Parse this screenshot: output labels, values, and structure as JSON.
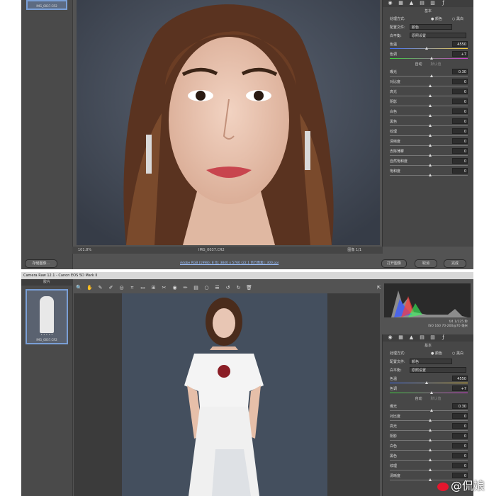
{
  "top_window": {
    "thumb_name": "IMG_0037.CR2",
    "zoom": "101.8%",
    "filename": "IMG_0037.CR2",
    "image_counter": "图像 1/1",
    "open_image_button": "打开图像",
    "cancel_button": "取消",
    "done_button": "完成",
    "batch_button": "存储图像...",
    "workflow_link": "Adobe RGB (1998); 8 位; 3840 x 5760 (22.1 百万像素); 300 ppi",
    "panel_title": "基本",
    "treatment_label": "处理方式:",
    "treatment_color": "颜色",
    "treatment_bw": "黑白",
    "profile_label": "配置文件:",
    "profile_value": "颜色",
    "wb_label": "白平衡:",
    "wb_value": "原照设置",
    "auto_label": "自动",
    "default_label": "默认值",
    "sliders": [
      {
        "label": "色温",
        "value": "4550",
        "pos": 0.45
      },
      {
        "label": "色调",
        "value": "+7",
        "pos": 0.52
      },
      {
        "label": "曝光",
        "value": "0.30",
        "pos": 0.52
      },
      {
        "label": "对比度",
        "value": "0",
        "pos": 0.5
      },
      {
        "label": "高光",
        "value": "0",
        "pos": 0.5
      },
      {
        "label": "阴影",
        "value": "0",
        "pos": 0.5
      },
      {
        "label": "白色",
        "value": "0",
        "pos": 0.5
      },
      {
        "label": "黑色",
        "value": "0",
        "pos": 0.5
      },
      {
        "label": "纹理",
        "value": "0",
        "pos": 0.5
      },
      {
        "label": "清晰度",
        "value": "0",
        "pos": 0.5
      },
      {
        "label": "去除薄雾",
        "value": "0",
        "pos": 0.5
      },
      {
        "label": "自然饱和度",
        "value": "0",
        "pos": 0.5
      },
      {
        "label": "饱和度",
        "value": "0",
        "pos": 0.5
      }
    ]
  },
  "bottom_window": {
    "title": "Camera Raw 12.1 - Canon EOS 5D Mark II",
    "filmstrip_header": "胶片",
    "thumb_name": "IMG_0037.CR2",
    "thumb_stars": "• • • • •",
    "exif_line1": "f/4   1/125 秒",
    "exif_line2": "ISO 160   70-200@70 毫米",
    "panel_title": "基本",
    "treatment_label": "处理方式:",
    "treatment_color": "颜色",
    "treatment_bw": "黑白",
    "profile_label": "配置文件:",
    "profile_value": "颜色",
    "wb_label": "白平衡:",
    "wb_value": "原照设置",
    "auto_label": "自动",
    "default_label": "默认值",
    "sliders": [
      {
        "label": "色温",
        "value": "4550",
        "pos": 0.45
      },
      {
        "label": "色调",
        "value": "+7",
        "pos": 0.52
      },
      {
        "label": "曝光",
        "value": "0.30",
        "pos": 0.52
      },
      {
        "label": "对比度",
        "value": "0",
        "pos": 0.5
      },
      {
        "label": "高光",
        "value": "0",
        "pos": 0.5
      },
      {
        "label": "阴影",
        "value": "0",
        "pos": 0.5
      },
      {
        "label": "白色",
        "value": "0",
        "pos": 0.5
      },
      {
        "label": "黑色",
        "value": "0",
        "pos": 0.5
      },
      {
        "label": "纹理",
        "value": "0",
        "pos": 0.5
      },
      {
        "label": "清晰度",
        "value": "0",
        "pos": 0.5
      }
    ]
  },
  "watermark": "@侃娘",
  "colors": {
    "ui_bg": "#535353",
    "panel_bg": "#474747",
    "photo_bg": "#3d4550",
    "accent": "#7a9fd6"
  }
}
